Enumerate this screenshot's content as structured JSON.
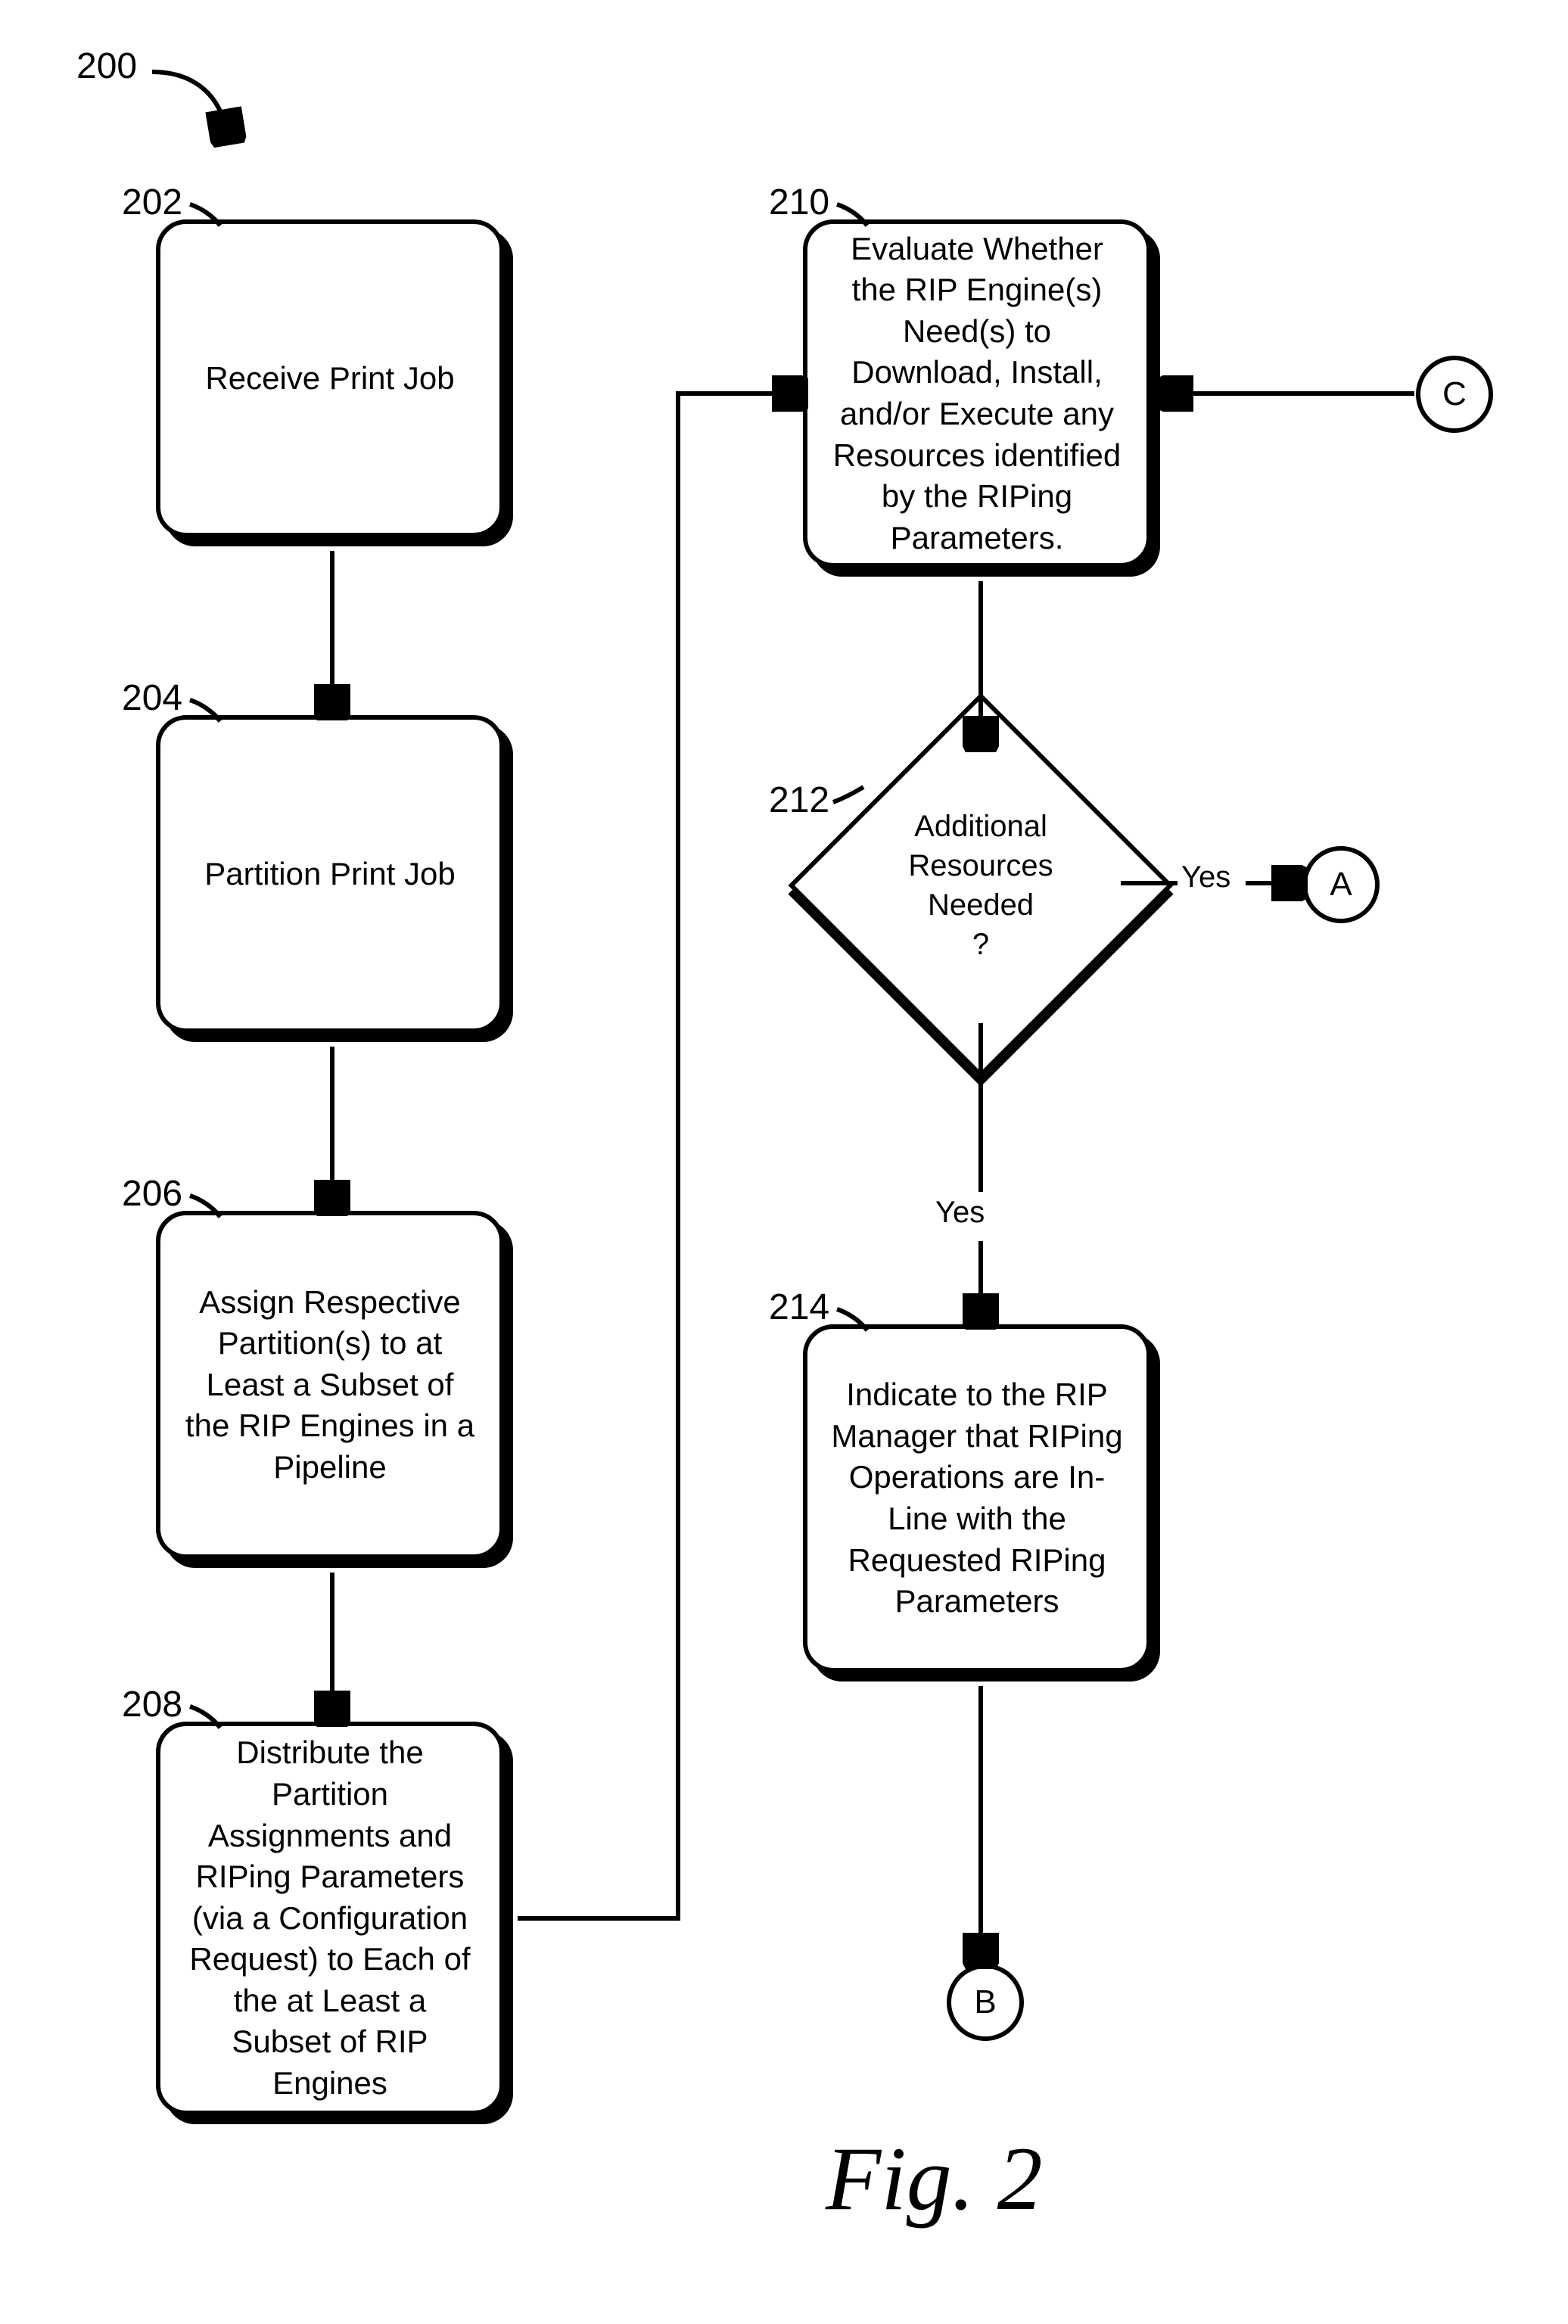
{
  "flow": {
    "ref200": "200",
    "ref202": "202",
    "ref204": "204",
    "ref206": "206",
    "ref208": "208",
    "ref210": "210",
    "ref212": "212",
    "ref214": "214",
    "box202": "Receive Print Job",
    "box204": "Partition Print Job",
    "box206": "Assign Respective Partition(s) to at Least a Subset of the RIP Engines in a Pipeline",
    "box208": "Distribute the Partition Assignments and RIPing Parameters (via a Configuration Request) to Each of the at Least a Subset of RIP Engines",
    "box210": "Evaluate Whether the RIP Engine(s) Need(s) to Download, Install, and/or Execute  any Resources identified by the RIPing Parameters.",
    "diamond212": "Additional Resources Needed\n?",
    "box214": "Indicate to the RIP Manager that RIPing Operations are In-Line with the Requested RIPing Parameters",
    "circleA": "A",
    "circleB": "B",
    "circleC": "C",
    "labelYes1": "Yes",
    "labelYes2": "Yes",
    "figCaption": "Fig. 2"
  }
}
